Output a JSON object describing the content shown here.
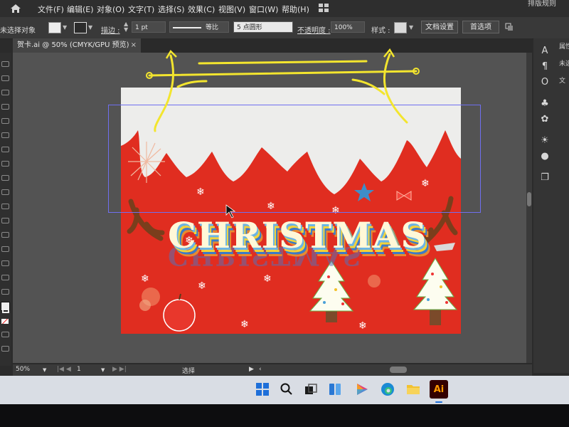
{
  "menubar": {
    "items": [
      "文件(F)",
      "编辑(E)",
      "对象(O)",
      "文字(T)",
      "选择(S)",
      "效果(C)",
      "视图(V)",
      "窗口(W)",
      "帮助(H)"
    ],
    "right_label": "排版规则"
  },
  "control_bar": {
    "selection_state": "未选择对象",
    "stroke_label": "描边 :",
    "stroke_weight": "1 pt",
    "stroke_profile": "等比",
    "brush": "5 点圆形",
    "opacity_label": "不透明度 :",
    "opacity_value": "100%",
    "style_label": "样式 :",
    "doc_settings": "文档设置",
    "preferences": "首选项"
  },
  "document_tab": {
    "title": "贺卡.ai @ 50% (CMYK/GPU 预览)",
    "close": "×"
  },
  "right_panel": {
    "labels": [
      "属性",
      "未选",
      "文"
    ]
  },
  "artboard": {
    "title_text": "CHRISTMAS",
    "colors": {
      "background": "#e02d20",
      "snow": "#ededeb",
      "antler": "#7a3e1c",
      "tree": "#fdfdf0",
      "selection": "#6f6ff0",
      "guide_yellow": "#f3e52e"
    }
  },
  "status_bar": {
    "zoom": "50%",
    "artboard_number": "1",
    "tool_status": "选择"
  },
  "taskbar": {
    "icons": [
      "windows-start-icon",
      "search-icon",
      "task-view-icon",
      "widgets-icon",
      "media-player-icon",
      "edge-icon",
      "file-explorer-icon",
      "illustrator-icon"
    ],
    "ai_label": "Ai"
  }
}
